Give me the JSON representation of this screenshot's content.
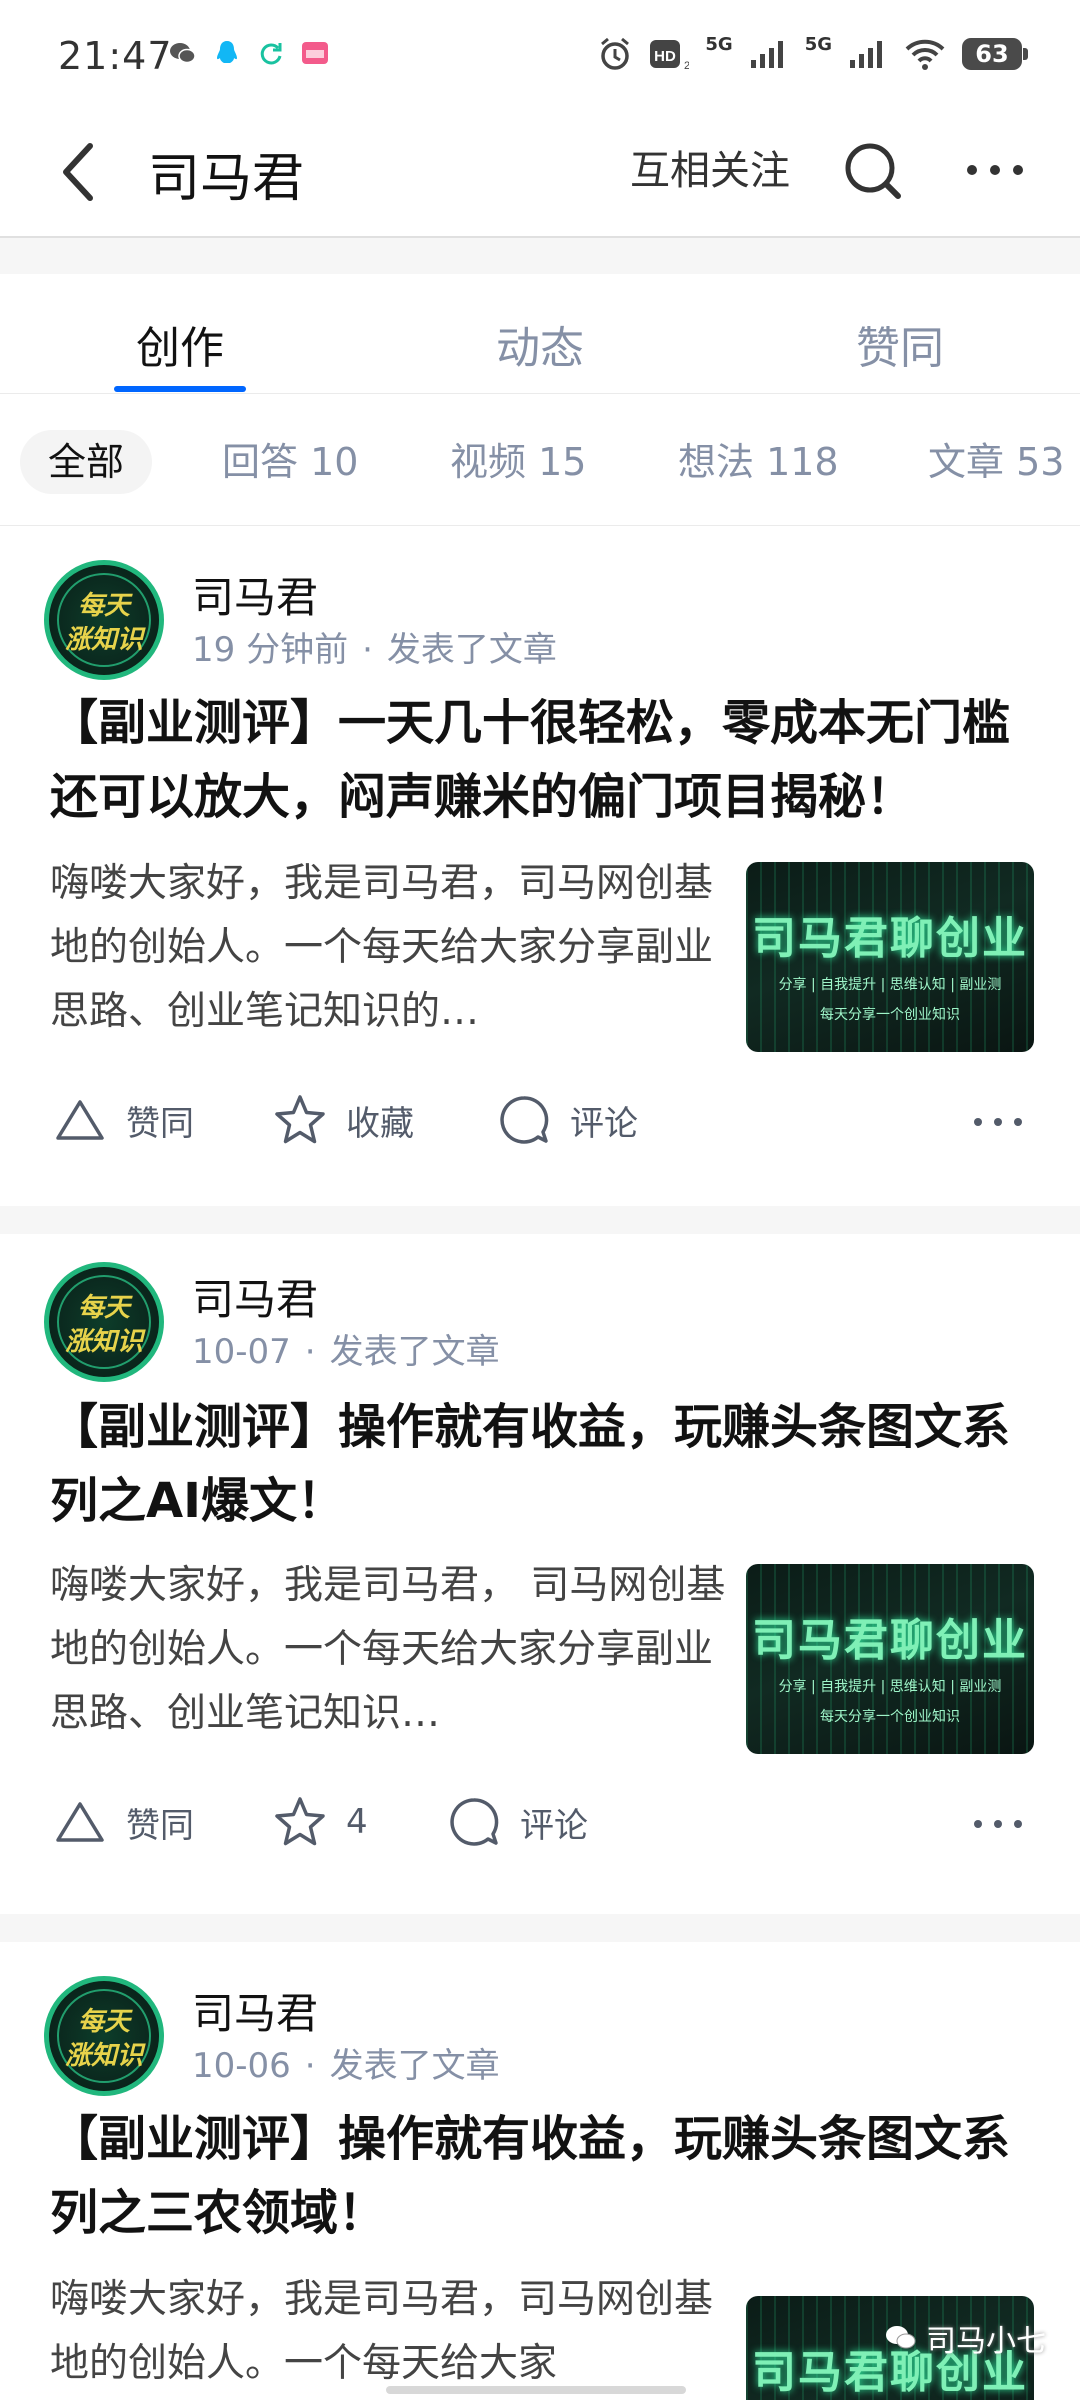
{
  "status_bar": {
    "time": "21:47",
    "battery": "63",
    "network_1": "5G",
    "network_2": "5G",
    "hd_label": "HD"
  },
  "header": {
    "title": "司马君",
    "follow_label": "互相关注"
  },
  "main_tabs": [
    {
      "label": "创作",
      "active": true
    },
    {
      "label": "动态",
      "active": false
    },
    {
      "label": "赞同",
      "active": false
    }
  ],
  "filters": [
    {
      "label": "全部",
      "active": true
    },
    {
      "label": "回答 10",
      "active": false
    },
    {
      "label": "视频 15",
      "active": false
    },
    {
      "label": "想法 118",
      "active": false
    },
    {
      "label": "文章 53",
      "active": false
    }
  ],
  "avatar_text": {
    "line1": "每天",
    "line2": "涨知识"
  },
  "thumbnail": {
    "title": "司马君聊创业",
    "subtitle": "分享 | 自我提升 | 思维认知 | 副业测",
    "subtitle2": "每天分享一个创业知识"
  },
  "posts": [
    {
      "author": "司马君",
      "time": "19 分钟前",
      "action": "发表了文章",
      "title": "【副业测评】一天几十很轻松，零成本无门槛还可以放大，闷声赚米的偏门项目揭秘！",
      "excerpt": "嗨喽大家好，我是司马君，司马网创基地的创始人。一个每天给大家分享副业思路、创业笔记知识的…",
      "like_label": "赞同",
      "fav_label": "收藏",
      "comment_label": "评论"
    },
    {
      "author": "司马君",
      "time": "10-07",
      "action": "发表了文章",
      "title": "【副业测评】操作就有收益，玩赚头条图文系列之AI爆文！",
      "excerpt": "嗨喽大家好，我是司马君， 司马网创基地的创始人。一个每天给大家分享副业思路、创业笔记知识…",
      "like_label": "赞同",
      "fav_label": "4",
      "comment_label": "评论"
    },
    {
      "author": "司马君",
      "time": "10-06",
      "action": "发表了文章",
      "title": "【副业测评】操作就有收益，玩赚头条图文系列之三农领域！",
      "excerpt": "嗨喽大家好，我是司马君，司马网创基地的创始人。一个每天给大家",
      "like_label": "赞同",
      "fav_label": "收藏",
      "comment_label": "评论"
    }
  ],
  "watermark": "司马小七",
  "colors": {
    "accent": "#0066ff",
    "muted": "#8590a6"
  }
}
